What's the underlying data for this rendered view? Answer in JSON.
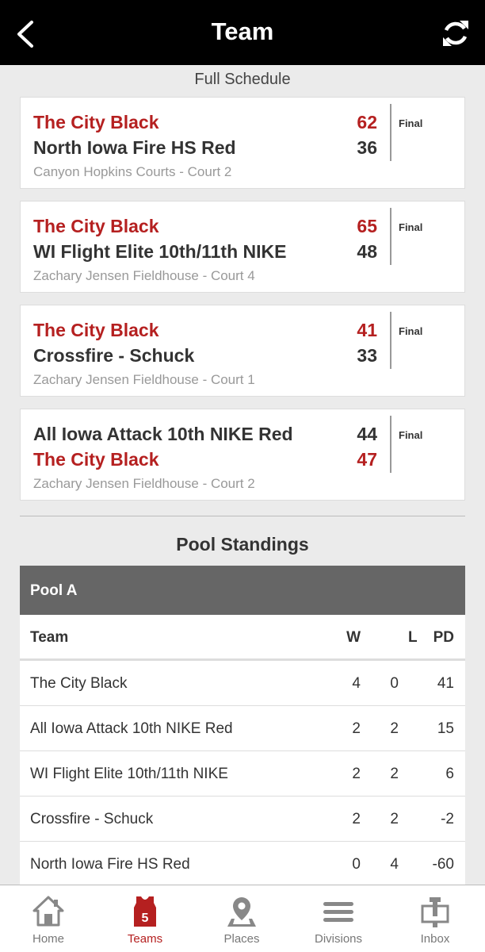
{
  "header": {
    "title": "Team"
  },
  "schedule_link": "Full Schedule",
  "games": [
    {
      "team1": "The City Black",
      "score1": "62",
      "team1_red": true,
      "team2": "North Iowa Fire HS Red",
      "score2": "36",
      "team2_red": false,
      "venue": "Canyon Hopkins Courts - Court 2",
      "status": "Final"
    },
    {
      "team1": "The City Black",
      "score1": "65",
      "team1_red": true,
      "team2": "WI Flight Elite 10th/11th NIKE",
      "score2": "48",
      "team2_red": false,
      "venue": "Zachary Jensen Fieldhouse - Court 4",
      "status": "Final"
    },
    {
      "team1": "The City Black",
      "score1": "41",
      "team1_red": true,
      "team2": "Crossfire - Schuck",
      "score2": "33",
      "team2_red": false,
      "venue": "Zachary Jensen Fieldhouse - Court 1",
      "status": "Final"
    },
    {
      "team1": "All Iowa Attack 10th NIKE Red",
      "score1": "44",
      "team1_red": false,
      "team2": "The City Black",
      "score2": "47",
      "team2_red": true,
      "venue": "Zachary Jensen Fieldhouse - Court 2",
      "status": "Final"
    }
  ],
  "standings": {
    "title": "Pool Standings",
    "pool": "Pool A",
    "columns": {
      "team": "Team",
      "w": "W",
      "l": "L",
      "pd": "PD"
    },
    "rows": [
      {
        "team": "The City Black",
        "w": "4",
        "l": "0",
        "pd": "41"
      },
      {
        "team": "All Iowa Attack 10th NIKE Red",
        "w": "2",
        "l": "2",
        "pd": "15"
      },
      {
        "team": "WI Flight Elite 10th/11th NIKE",
        "w": "2",
        "l": "2",
        "pd": "6"
      },
      {
        "team": "Crossfire - Schuck",
        "w": "2",
        "l": "2",
        "pd": "-2"
      },
      {
        "team": "North Iowa Fire HS Red",
        "w": "0",
        "l": "4",
        "pd": "-60"
      }
    ]
  },
  "tabbar": {
    "home": "Home",
    "teams": "Teams",
    "teams_badge": "5",
    "places": "Places",
    "divisions": "Divisions",
    "inbox": "Inbox"
  },
  "colors": {
    "accent_red": "#b52020",
    "header_bg": "#000000",
    "pool_header_bg": "#666666"
  }
}
